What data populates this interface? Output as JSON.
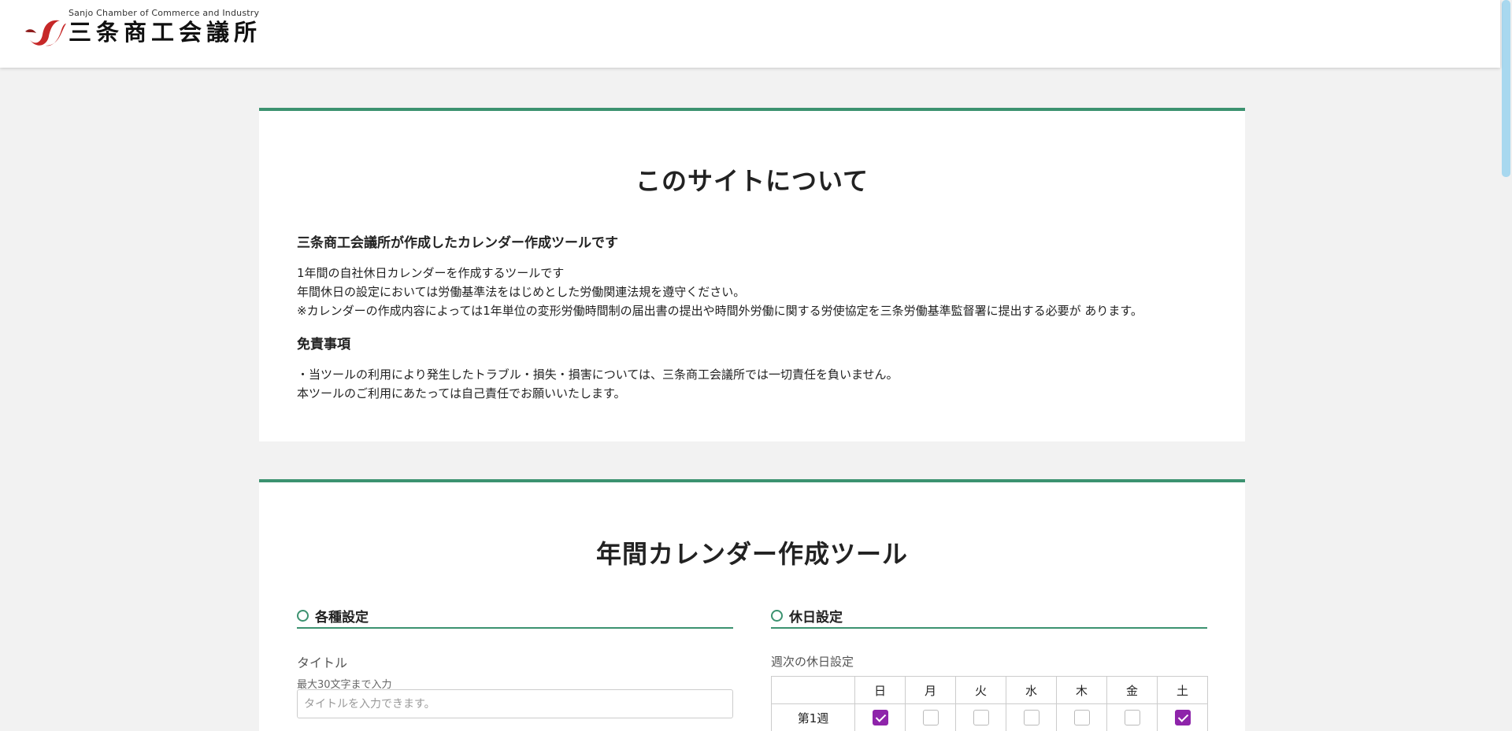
{
  "header": {
    "logo_sub": "Sanjo Chamber of Commerce and Industry",
    "logo_main": "三条商工会議所",
    "brand_color": "#c62828"
  },
  "about": {
    "title": "このサイトについて",
    "heading": "三条商工会議所が作成したカレンダー作成ツールです",
    "lines": [
      "1年間の自社休日カレンダーを作成するツールです",
      "年間休日の設定においては労働基準法をはじめとした労働関連法規を遵守ください。",
      "※カレンダーの作成内容によっては1年単位の変形労働時間制の届出書の提出や時間外労働に関する労使協定を三条労働基準監督署に提出する必要が あります。"
    ],
    "disclaimer_heading": "免責事項",
    "disclaimer_lines": [
      "・当ツールの利用により発生したトラブル・損失・損害については、三条商工会議所では一切責任を負いません。",
      "本ツールのご利用にあたっては自己責任でお願いいたします。"
    ]
  },
  "tool": {
    "title": "年間カレンダー作成ツール",
    "settings": {
      "heading": "各種設定",
      "title_label": "タイトル",
      "title_hint": "最大30文字まで入力",
      "title_placeholder": "タイトルを入力できます。",
      "title_value": ""
    },
    "holidays": {
      "heading": "休日設定",
      "weekly_label": "週次の休日設定",
      "days": [
        "日",
        "月",
        "火",
        "水",
        "木",
        "金",
        "土"
      ],
      "rows": [
        {
          "label": "第1週",
          "checked": [
            true,
            false,
            false,
            false,
            false,
            false,
            true
          ]
        }
      ]
    }
  },
  "colors": {
    "accent": "#3c9270",
    "checkbox_on": "#8e24aa"
  }
}
